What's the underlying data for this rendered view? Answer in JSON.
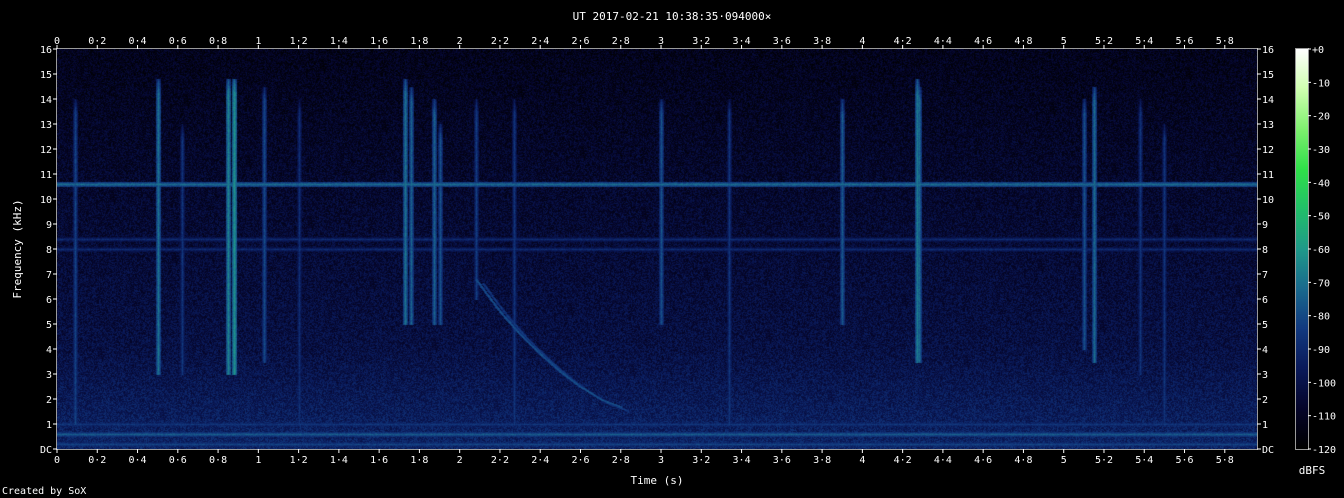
{
  "chart_data": {
    "type": "heatmap",
    "title": "UT 2017-02-21 10:38:35·094000×",
    "xlabel": "Time (s)",
    "ylabel": "Frequency (kHz)",
    "xlim": [
      0,
      5.96
    ],
    "ylim": [
      0,
      16
    ],
    "x_ticks": [
      "0",
      "0·2",
      "0·4",
      "0·6",
      "0·8",
      "1",
      "1·2",
      "1·4",
      "1·6",
      "1·8",
      "2",
      "2·2",
      "2·4",
      "2·6",
      "2·8",
      "3",
      "3·2",
      "3·4",
      "3·6",
      "3·8",
      "4",
      "4·2",
      "4·4",
      "4·6",
      "4·8",
      "5",
      "5·2",
      "5·4",
      "5·6",
      "5·8"
    ],
    "y_ticks": [
      "DC",
      "1",
      "2",
      "3",
      "4",
      "5",
      "6",
      "7",
      "8",
      "9",
      "10",
      "11",
      "12",
      "13",
      "14",
      "15",
      "16"
    ],
    "colorbar": {
      "label": "dBFS",
      "ticks": [
        "+0",
        "-10",
        "-20",
        "-30",
        "-40",
        "-50",
        "-60",
        "-70",
        "-80",
        "-90",
        "-100",
        "-110",
        "-120"
      ],
      "range": [
        -120,
        0
      ],
      "colors": [
        "#000000",
        "#05052a",
        "#0a1a5a",
        "#123a80",
        "#1a6a8e",
        "#1f9a8a",
        "#22c06a",
        "#30e04a",
        "#80f070",
        "#d0ffb0",
        "#ffffff"
      ]
    },
    "background_db": -98,
    "horizontal_bands": [
      {
        "freq_khz": 10.6,
        "db": -72
      },
      {
        "freq_khz": 0.6,
        "db": -76
      },
      {
        "freq_khz": 0.2,
        "db": -82
      },
      {
        "freq_khz": 1.0,
        "db": -86
      },
      {
        "freq_khz": 8.4,
        "db": -90
      },
      {
        "freq_khz": 8.0,
        "db": -90
      }
    ],
    "vertical_events": [
      {
        "t": 0.09,
        "f_low": 1,
        "f_high": 14,
        "db": -82
      },
      {
        "t": 0.5,
        "f_low": 3,
        "f_high": 14.8,
        "db": -70
      },
      {
        "t": 0.62,
        "f_low": 3,
        "f_high": 13,
        "db": -86
      },
      {
        "t": 0.85,
        "f_low": 3,
        "f_high": 14.8,
        "db": -66
      },
      {
        "t": 0.88,
        "f_low": 3,
        "f_high": 14.8,
        "db": -62
      },
      {
        "t": 1.03,
        "f_low": 3.5,
        "f_high": 14.5,
        "db": -80
      },
      {
        "t": 1.2,
        "f_low": 1,
        "f_high": 14,
        "db": -88
      },
      {
        "t": 1.73,
        "f_low": 5,
        "f_high": 14.8,
        "db": -70
      },
      {
        "t": 1.76,
        "f_low": 5,
        "f_high": 14.5,
        "db": -74
      },
      {
        "t": 1.87,
        "f_low": 5,
        "f_high": 14,
        "db": -74
      },
      {
        "t": 1.9,
        "f_low": 5,
        "f_high": 13,
        "db": -78
      },
      {
        "t": 2.08,
        "f_low": 6,
        "f_high": 14,
        "db": -84
      },
      {
        "t": 2.27,
        "f_low": 1,
        "f_high": 14,
        "db": -86
      },
      {
        "t": 3.0,
        "f_low": 5,
        "f_high": 14,
        "db": -78
      },
      {
        "t": 3.34,
        "f_low": 1,
        "f_high": 14,
        "db": -86
      },
      {
        "t": 3.9,
        "f_low": 5,
        "f_high": 14,
        "db": -76
      },
      {
        "t": 4.27,
        "f_low": 3.5,
        "f_high": 14.8,
        "db": -68
      },
      {
        "t": 4.28,
        "f_low": 3.5,
        "f_high": 14.5,
        "db": -72
      },
      {
        "t": 5.1,
        "f_low": 4,
        "f_high": 14,
        "db": -78
      },
      {
        "t": 5.15,
        "f_low": 3.5,
        "f_high": 14.5,
        "db": -72
      },
      {
        "t": 5.38,
        "f_low": 3,
        "f_high": 14,
        "db": -86
      },
      {
        "t": 5.5,
        "f_low": 1,
        "f_high": 13,
        "db": -86
      }
    ],
    "sweep": [
      {
        "t": 2.08,
        "f": 6.8
      },
      {
        "t": 2.2,
        "f": 5.5
      },
      {
        "t": 2.3,
        "f": 4.6
      },
      {
        "t": 2.4,
        "f": 3.8
      },
      {
        "t": 2.5,
        "f": 3.1
      },
      {
        "t": 2.6,
        "f": 2.5
      },
      {
        "t": 2.7,
        "f": 2.0
      },
      {
        "t": 2.8,
        "f": 1.7
      }
    ],
    "sweep_db": -80
  },
  "footer": {
    "credit": "Created by SoX"
  }
}
